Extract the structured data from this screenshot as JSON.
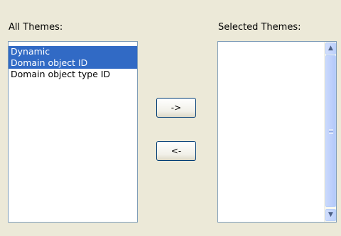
{
  "all_themes": {
    "label": "All Themes:",
    "items": [
      {
        "label": "Dynamic",
        "selected": true
      },
      {
        "label": "Domain object ID",
        "selected": true
      },
      {
        "label": "Domain object type ID",
        "selected": false
      }
    ]
  },
  "buttons": {
    "add_label": "->",
    "remove_label": "<-"
  },
  "selected_themes": {
    "label": "Selected Themes:",
    "items": []
  },
  "colors": {
    "background": "#ece9d8",
    "selection": "#316ac5",
    "list_border": "#7f9db9"
  },
  "icons": {
    "scroll_up": "chevron-up-icon",
    "scroll_down": "chevron-down-icon"
  }
}
